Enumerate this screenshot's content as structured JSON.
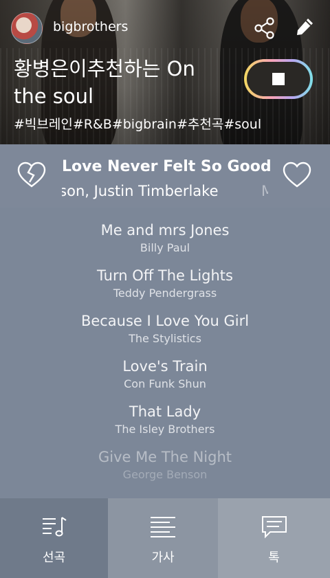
{
  "header": {
    "username": "bigbrothers",
    "title": "황병은이추천하는 On the soul",
    "tags": "#빅브레인#R&B#bigbrain#추천곡#soul",
    "icons": {
      "share": "share-icon",
      "edit": "pencil-icon",
      "stop": "stop-icon"
    },
    "stop_ring_colors": [
      "#f2d861",
      "#f7a3b8",
      "#b9a6f0",
      "#7ee0e6"
    ]
  },
  "now_playing": {
    "title": "Love Never Felt So Good",
    "artist": "kson, Justin Timberlake",
    "artist_next": "M",
    "icons": {
      "dislike": "broken-heart-icon",
      "like": "heart-icon"
    }
  },
  "playlist": [
    {
      "title": "Me and mrs Jones",
      "artist": "Billy Paul"
    },
    {
      "title": "Turn Off The Lights",
      "artist": "Teddy Pendergrass"
    },
    {
      "title": "Because I Love You Girl",
      "artist": "The Stylistics"
    },
    {
      "title": "Love's Train",
      "artist": "Con Funk Shun"
    },
    {
      "title": "That Lady",
      "artist": "The Isley Brothers"
    },
    {
      "title": "Give Me The Night",
      "artist": "George Benson"
    }
  ],
  "tabs": [
    {
      "label": "선곡",
      "icon": "music-list-icon"
    },
    {
      "label": "가사",
      "icon": "lyrics-icon"
    },
    {
      "label": "톡",
      "icon": "chat-icon"
    }
  ]
}
